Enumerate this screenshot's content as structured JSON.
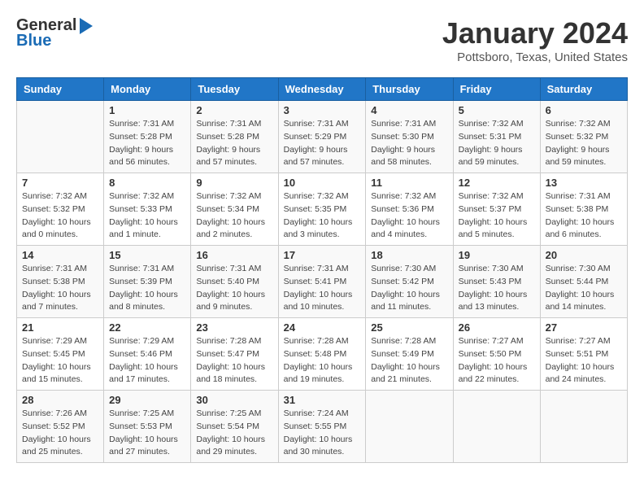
{
  "header": {
    "logo_general": "General",
    "logo_blue": "Blue",
    "month": "January 2024",
    "location": "Pottsboro, Texas, United States"
  },
  "columns": [
    "Sunday",
    "Monday",
    "Tuesday",
    "Wednesday",
    "Thursday",
    "Friday",
    "Saturday"
  ],
  "weeks": [
    [
      {
        "day": "",
        "detail": ""
      },
      {
        "day": "1",
        "detail": "Sunrise: 7:31 AM\nSunset: 5:28 PM\nDaylight: 9 hours\nand 56 minutes."
      },
      {
        "day": "2",
        "detail": "Sunrise: 7:31 AM\nSunset: 5:28 PM\nDaylight: 9 hours\nand 57 minutes."
      },
      {
        "day": "3",
        "detail": "Sunrise: 7:31 AM\nSunset: 5:29 PM\nDaylight: 9 hours\nand 57 minutes."
      },
      {
        "day": "4",
        "detail": "Sunrise: 7:31 AM\nSunset: 5:30 PM\nDaylight: 9 hours\nand 58 minutes."
      },
      {
        "day": "5",
        "detail": "Sunrise: 7:32 AM\nSunset: 5:31 PM\nDaylight: 9 hours\nand 59 minutes."
      },
      {
        "day": "6",
        "detail": "Sunrise: 7:32 AM\nSunset: 5:32 PM\nDaylight: 9 hours\nand 59 minutes."
      }
    ],
    [
      {
        "day": "7",
        "detail": "Sunrise: 7:32 AM\nSunset: 5:32 PM\nDaylight: 10 hours\nand 0 minutes."
      },
      {
        "day": "8",
        "detail": "Sunrise: 7:32 AM\nSunset: 5:33 PM\nDaylight: 10 hours\nand 1 minute."
      },
      {
        "day": "9",
        "detail": "Sunrise: 7:32 AM\nSunset: 5:34 PM\nDaylight: 10 hours\nand 2 minutes."
      },
      {
        "day": "10",
        "detail": "Sunrise: 7:32 AM\nSunset: 5:35 PM\nDaylight: 10 hours\nand 3 minutes."
      },
      {
        "day": "11",
        "detail": "Sunrise: 7:32 AM\nSunset: 5:36 PM\nDaylight: 10 hours\nand 4 minutes."
      },
      {
        "day": "12",
        "detail": "Sunrise: 7:32 AM\nSunset: 5:37 PM\nDaylight: 10 hours\nand 5 minutes."
      },
      {
        "day": "13",
        "detail": "Sunrise: 7:31 AM\nSunset: 5:38 PM\nDaylight: 10 hours\nand 6 minutes."
      }
    ],
    [
      {
        "day": "14",
        "detail": "Sunrise: 7:31 AM\nSunset: 5:38 PM\nDaylight: 10 hours\nand 7 minutes."
      },
      {
        "day": "15",
        "detail": "Sunrise: 7:31 AM\nSunset: 5:39 PM\nDaylight: 10 hours\nand 8 minutes."
      },
      {
        "day": "16",
        "detail": "Sunrise: 7:31 AM\nSunset: 5:40 PM\nDaylight: 10 hours\nand 9 minutes."
      },
      {
        "day": "17",
        "detail": "Sunrise: 7:31 AM\nSunset: 5:41 PM\nDaylight: 10 hours\nand 10 minutes."
      },
      {
        "day": "18",
        "detail": "Sunrise: 7:30 AM\nSunset: 5:42 PM\nDaylight: 10 hours\nand 11 minutes."
      },
      {
        "day": "19",
        "detail": "Sunrise: 7:30 AM\nSunset: 5:43 PM\nDaylight: 10 hours\nand 13 minutes."
      },
      {
        "day": "20",
        "detail": "Sunrise: 7:30 AM\nSunset: 5:44 PM\nDaylight: 10 hours\nand 14 minutes."
      }
    ],
    [
      {
        "day": "21",
        "detail": "Sunrise: 7:29 AM\nSunset: 5:45 PM\nDaylight: 10 hours\nand 15 minutes."
      },
      {
        "day": "22",
        "detail": "Sunrise: 7:29 AM\nSunset: 5:46 PM\nDaylight: 10 hours\nand 17 minutes."
      },
      {
        "day": "23",
        "detail": "Sunrise: 7:28 AM\nSunset: 5:47 PM\nDaylight: 10 hours\nand 18 minutes."
      },
      {
        "day": "24",
        "detail": "Sunrise: 7:28 AM\nSunset: 5:48 PM\nDaylight: 10 hours\nand 19 minutes."
      },
      {
        "day": "25",
        "detail": "Sunrise: 7:28 AM\nSunset: 5:49 PM\nDaylight: 10 hours\nand 21 minutes."
      },
      {
        "day": "26",
        "detail": "Sunrise: 7:27 AM\nSunset: 5:50 PM\nDaylight: 10 hours\nand 22 minutes."
      },
      {
        "day": "27",
        "detail": "Sunrise: 7:27 AM\nSunset: 5:51 PM\nDaylight: 10 hours\nand 24 minutes."
      }
    ],
    [
      {
        "day": "28",
        "detail": "Sunrise: 7:26 AM\nSunset: 5:52 PM\nDaylight: 10 hours\nand 25 minutes."
      },
      {
        "day": "29",
        "detail": "Sunrise: 7:25 AM\nSunset: 5:53 PM\nDaylight: 10 hours\nand 27 minutes."
      },
      {
        "day": "30",
        "detail": "Sunrise: 7:25 AM\nSunset: 5:54 PM\nDaylight: 10 hours\nand 29 minutes."
      },
      {
        "day": "31",
        "detail": "Sunrise: 7:24 AM\nSunset: 5:55 PM\nDaylight: 10 hours\nand 30 minutes."
      },
      {
        "day": "",
        "detail": ""
      },
      {
        "day": "",
        "detail": ""
      },
      {
        "day": "",
        "detail": ""
      }
    ]
  ]
}
